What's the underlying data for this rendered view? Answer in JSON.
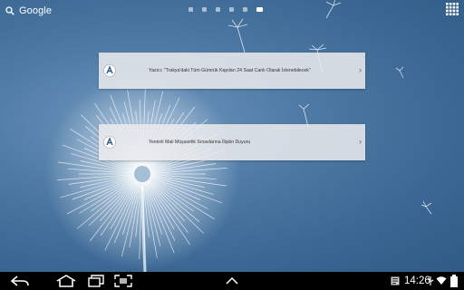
{
  "top_bar": {
    "search_label": "Google",
    "page_count": 6,
    "active_page": 6
  },
  "widgets": [
    {
      "headline": "Yazıcı: \"Trakya'daki Tüm Gümrük Kapıları 24 Saat Canlı Olarak İzlenebilecek\""
    },
    {
      "headline": "Yeminli Mali Müşavirlik Sınavlarına İlişkin Duyuru"
    }
  ],
  "status_bar": {
    "time": "14:26"
  },
  "colors": {
    "wallpaper": "#3a6793",
    "widget_bg": "#ebebee",
    "nav_bar": "#000000",
    "icon_white": "#ffffff"
  },
  "icons": [
    "search-icon",
    "app-drawer-icon",
    "back-icon",
    "home-icon",
    "recent-apps-icon",
    "screenshot-icon",
    "up-chevron-icon",
    "notification-icon",
    "usb-icon",
    "wifi-icon",
    "battery-icon"
  ]
}
